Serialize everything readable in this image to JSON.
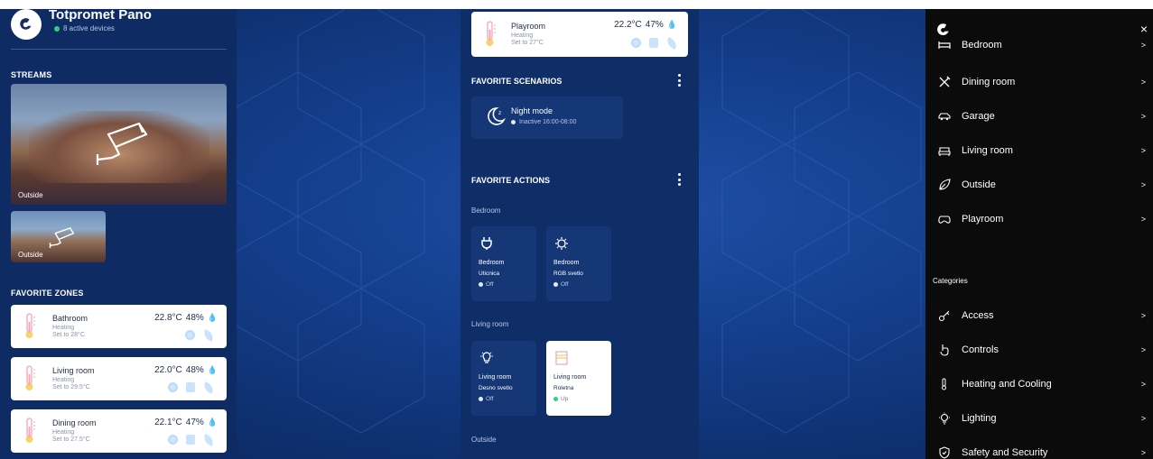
{
  "colors": {
    "accent": "#1f4fa6",
    "panel": "#0e2b63",
    "drawer": "#0b0b0c",
    "status_on": "#31d07a",
    "humidity": "#3aa0e8"
  },
  "left": {
    "brand_title": "Totpromet Pano",
    "brand_sub": "8 active devices",
    "streams_label": "STREAMS",
    "streams": [
      {
        "label": "Outside"
      },
      {
        "label": "Outside"
      }
    ],
    "zones_label": "FAVORITE ZONES",
    "zones": [
      {
        "name": "Bathroom",
        "mode": "Heating",
        "setpoint": "Set to 28°C",
        "temp": "22.8°C",
        "humidity": "48%"
      },
      {
        "name": "Living room",
        "mode": "Heating",
        "setpoint": "Set to 29.5°C",
        "temp": "22.0°C",
        "humidity": "48%"
      },
      {
        "name": "Dining room",
        "mode": "Heating",
        "setpoint": "Set to 27.5°C",
        "temp": "22.1°C",
        "humidity": "47%"
      }
    ]
  },
  "mid": {
    "top_zone": {
      "name": "Playroom",
      "mode": "Heating",
      "setpoint": "Set to 27°C",
      "temp": "22.2°C",
      "humidity": "47%"
    },
    "scenarios_label": "FAVORITE SCENARIOS",
    "scenario": {
      "name": "Night mode",
      "status": "Inactive 16:00-08:00"
    },
    "actions_label": "FAVORITE ACTIONS",
    "group_bedroom": "Bedroom",
    "group_living": "Living room",
    "group_outside": "Outside",
    "actions": [
      {
        "room": "Bedroom",
        "device": "Uticnica",
        "status": "Off",
        "icon": "plug-icon"
      },
      {
        "room": "Bedroom",
        "device": "RGB svetlo",
        "status": "Off",
        "icon": "rgb-light-icon"
      },
      {
        "room": "Living room",
        "device": "Desno svetlo",
        "status": "Off",
        "icon": "bulb-icon"
      },
      {
        "room": "Living room",
        "device": "Roletna",
        "status": "Up",
        "icon": "blinds-icon"
      }
    ]
  },
  "drawer": {
    "rooms": [
      {
        "label": "Bedroom",
        "icon": "bed-icon"
      },
      {
        "label": "Dining room",
        "icon": "cutlery-icon"
      },
      {
        "label": "Garage",
        "icon": "car-icon"
      },
      {
        "label": "Living room",
        "icon": "sofa-icon"
      },
      {
        "label": "Outside",
        "icon": "leaf-icon"
      },
      {
        "label": "Playroom",
        "icon": "gamepad-icon"
      }
    ],
    "categories_label": "Categories",
    "categories": [
      {
        "label": "Access",
        "icon": "key-icon"
      },
      {
        "label": "Controls",
        "icon": "hand-icon"
      },
      {
        "label": "Heating and Cooling",
        "icon": "thermometer-icon"
      },
      {
        "label": "Lighting",
        "icon": "bulb-icon"
      },
      {
        "label": "Safety and Security",
        "icon": "shield-icon"
      }
    ],
    "chevron": ">",
    "close": "×"
  }
}
